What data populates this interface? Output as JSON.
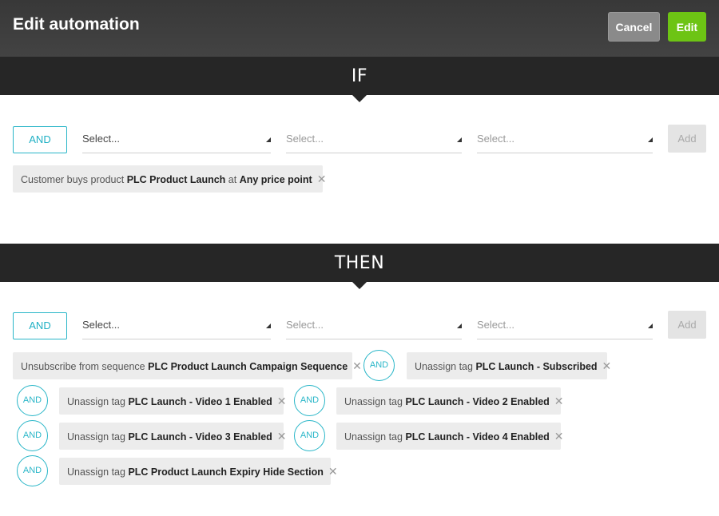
{
  "header": {
    "title": "Edit automation",
    "cancel_label": "Cancel",
    "edit_label": "Edit"
  },
  "if_section": {
    "label": "IF",
    "and_label": "AND",
    "selects": [
      "Select...",
      "Select...",
      "Select..."
    ],
    "add_label": "Add",
    "conditions": [
      {
        "prefix": "Customer buys product ",
        "bold1": "PLC Product Launch",
        "mid": " at ",
        "bold2": "Any price point"
      }
    ]
  },
  "then_section": {
    "label": "THEN",
    "and_label": "AND",
    "selects": [
      "Select...",
      "Select...",
      "Select..."
    ],
    "add_label": "Add",
    "connector_label": "AND",
    "actions": [
      {
        "prefix": "Unsubscribe from sequence ",
        "bold": "PLC Product Launch Campaign Sequence"
      },
      {
        "prefix": "Unassign tag ",
        "bold": "PLC Launch - Subscribed"
      },
      {
        "prefix": "Unassign tag ",
        "bold": "PLC Launch - Video 1 Enabled"
      },
      {
        "prefix": "Unassign tag ",
        "bold": "PLC Launch - Video 2 Enabled"
      },
      {
        "prefix": "Unassign tag ",
        "bold": "PLC Launch - Video 3 Enabled"
      },
      {
        "prefix": "Unassign tag ",
        "bold": "PLC Launch - Video 4 Enabled"
      },
      {
        "prefix": "Unassign tag ",
        "bold": "PLC Product Launch Expiry Hide Section"
      }
    ]
  },
  "icons": {
    "remove": "close-icon",
    "dropdown": "caret-icon"
  },
  "colors": {
    "accent": "#29b6c8",
    "edit": "#6dc414",
    "cancel": "#8a8a8a",
    "bar": "#262626",
    "header": "#3a3a3a"
  }
}
